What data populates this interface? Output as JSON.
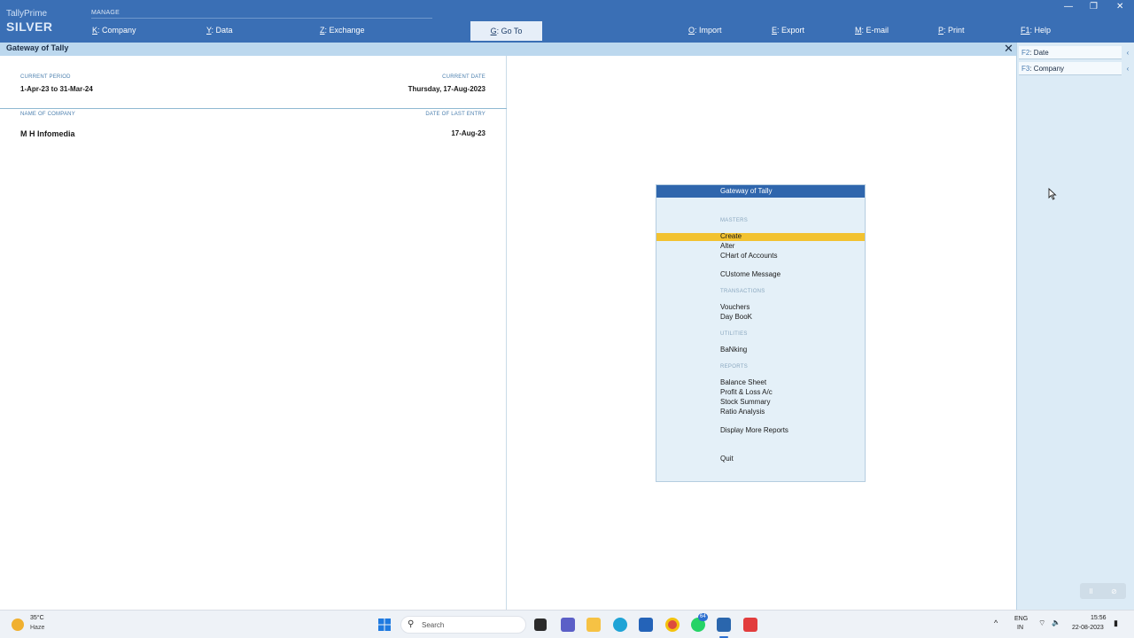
{
  "window": {
    "brand_name": "TallyPrime",
    "brand_edition": "SILVER",
    "minimize": "—",
    "restore": "❐",
    "close": "✕"
  },
  "topbar": {
    "manage_label": "MANAGE",
    "menu": [
      {
        "key": "K",
        "label": ": Company"
      },
      {
        "key": "Y",
        "label": ": Data"
      },
      {
        "key": "Z",
        "label": ": Exchange"
      },
      {
        "key": "G",
        "label": ": Go To"
      },
      {
        "key": "O",
        "label": ": Import"
      },
      {
        "key": "E",
        "label": ": Export"
      },
      {
        "key": "M",
        "label": ": E-mail"
      },
      {
        "key": "P",
        "label": ": Print"
      },
      {
        "key": "F1",
        "label": ": Help"
      }
    ]
  },
  "screen": {
    "title": "Gateway of Tally",
    "close_glyph": "✕"
  },
  "info": {
    "current_period_label": "CURRENT PERIOD",
    "current_period": "1-Apr-23 to 31-Mar-24",
    "current_date_label": "CURRENT DATE",
    "current_date": "Thursday, 17-Aug-2023",
    "company_col_label": "NAME OF COMPANY",
    "last_entry_col_label": "DATE OF LAST ENTRY",
    "company_name": "M H Infomedia",
    "last_entry_date": "17-Aug-23"
  },
  "side_buttons": [
    {
      "key": "F2",
      "label": ": Date",
      "arrow": "‹"
    },
    {
      "key": "F3",
      "label": ": Company",
      "arrow": "‹"
    }
  ],
  "gateway": {
    "header": "Gateway of Tally",
    "sections": {
      "masters": "MASTERS",
      "transactions": "TRANSACTIONS",
      "utilities": "UTILITIES",
      "reports": "REPORTS"
    },
    "items": {
      "create": "Create",
      "alter": "Alter",
      "chart": "CHart of Accounts",
      "custom": "CUstome Message",
      "vouchers": "Vouchers",
      "daybook": "Day BooK",
      "banking": "BaNking",
      "balance": "Balance Sheet",
      "pl": "Profit & Loss A/c",
      "stock": "Stock Summary",
      "ratio": "Ratio Analysis",
      "more": "Display More Reports",
      "quit": "Quit"
    },
    "selected_color": "#f2c230"
  },
  "recorder": {
    "pause": "II",
    "stop": "⊘"
  },
  "taskbar": {
    "temperature": "35°C",
    "weather": "Haze",
    "search_placeholder": "Search",
    "search_glyph": "⚲",
    "whatsapp_badge": "64",
    "lang_top": "ENG",
    "lang_bottom": "IN",
    "time": "15:56",
    "date": "22-08-2023",
    "tray_up": "^",
    "wifi": "⌔",
    "volume": "🔈",
    "battery": "▮"
  },
  "colors": {
    "topbar": "#3a6fb5",
    "title_strip": "#bcd8ee",
    "gateway_header": "#2f66ad",
    "highlight": "#f2c230"
  }
}
